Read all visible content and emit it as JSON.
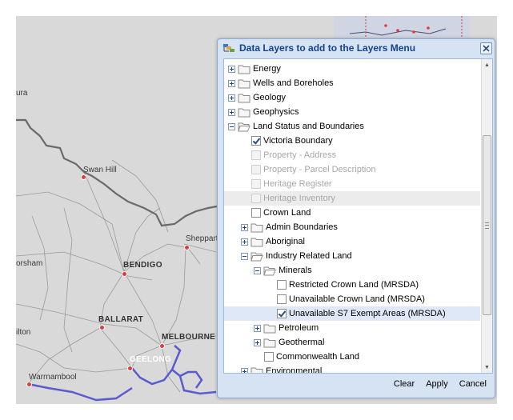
{
  "map": {
    "labels": {
      "ura": "ura",
      "swan_hill": "Swan Hill",
      "shepparton": "Sheppart",
      "horsham": "orsham",
      "bendigo": "BENDIGO",
      "ballarat": "BALLARAT",
      "hamilton": "ilton",
      "melbourne": "MELBOURNE",
      "geelong": "GEELONG",
      "warrnambool": "Warrnambool"
    },
    "colors": {
      "land": "#d9d9d9",
      "roads": "#8a8a8a",
      "border": "#5a5a5a",
      "coastline": "#5b5bd0",
      "city_dot": "#e23a3a"
    }
  },
  "dialog": {
    "title": "Data Layers to add to the Layers Menu",
    "tree": [
      {
        "label": "Energy",
        "type": "folder",
        "expanded": false
      },
      {
        "label": "Wells and Boreholes",
        "type": "folder",
        "expanded": false
      },
      {
        "label": "Geology",
        "type": "folder",
        "expanded": false
      },
      {
        "label": "Geophysics",
        "type": "folder",
        "expanded": false
      },
      {
        "label": "Land Status and Boundaries",
        "type": "folder",
        "expanded": true
      },
      {
        "label": "Victoria Boundary",
        "type": "layer",
        "checked": true
      },
      {
        "label": "Property - Address",
        "type": "layer",
        "disabled": true
      },
      {
        "label": "Property - Parcel Description",
        "type": "layer",
        "disabled": true
      },
      {
        "label": "Heritage Register",
        "type": "layer",
        "disabled": true
      },
      {
        "label": "Heritage Inventory",
        "type": "layer",
        "disabled": true
      },
      {
        "label": "Crown Land",
        "type": "layer",
        "checked": false
      },
      {
        "label": "Admin Boundaries",
        "type": "folder",
        "expanded": false
      },
      {
        "label": "Aboriginal",
        "type": "folder",
        "expanded": false
      },
      {
        "label": "Industry Related Land",
        "type": "folder",
        "expanded": true
      },
      {
        "label": "Minerals",
        "type": "folder",
        "expanded": true
      },
      {
        "label": "Restricted Crown Land (MRSDA)",
        "type": "layer",
        "checked": false
      },
      {
        "label": "Unavailable Crown Land (MRSDA)",
        "type": "layer",
        "checked": false
      },
      {
        "label": "Unavailable S7 Exempt Areas (MRSDA)",
        "type": "layer",
        "checked": true
      },
      {
        "label": "Petroleum",
        "type": "folder",
        "expanded": false
      },
      {
        "label": "Geothermal",
        "type": "folder",
        "expanded": false
      },
      {
        "label": "Commonwealth Land",
        "type": "layer",
        "checked": false
      },
      {
        "label": "Environmental",
        "type": "folder",
        "expanded": false
      }
    ],
    "buttons": {
      "clear": "Clear",
      "apply": "Apply",
      "cancel": "Cancel"
    }
  }
}
